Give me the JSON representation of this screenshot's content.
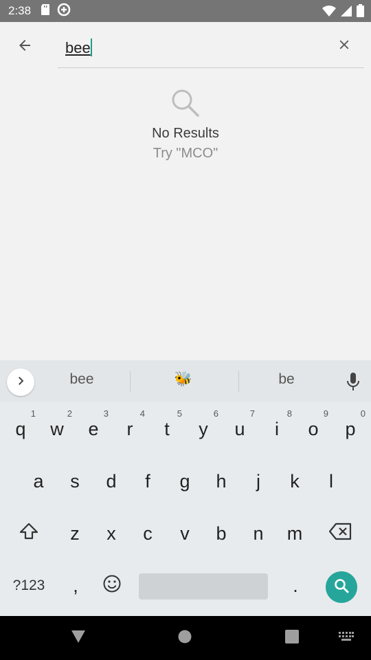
{
  "status_bar": {
    "time": "2:38",
    "left_icons": [
      "sd-card-icon",
      "data-saver-icon"
    ],
    "right_icons": [
      "wifi-icon",
      "cell-signal-icon",
      "battery-icon"
    ]
  },
  "search": {
    "query": "bee",
    "back_icon": "arrow-back-icon",
    "clear_icon": "close-icon"
  },
  "empty_state": {
    "icon": "search-icon",
    "title": "No Results",
    "suggestion": "Try \"MCO\""
  },
  "keyboard": {
    "suggestions": [
      "bee",
      "🐝",
      "be"
    ],
    "row1": [
      {
        "key": "q",
        "hint": "1"
      },
      {
        "key": "w",
        "hint": "2"
      },
      {
        "key": "e",
        "hint": "3"
      },
      {
        "key": "r",
        "hint": "4"
      },
      {
        "key": "t",
        "hint": "5"
      },
      {
        "key": "y",
        "hint": "6"
      },
      {
        "key": "u",
        "hint": "7"
      },
      {
        "key": "i",
        "hint": "8"
      },
      {
        "key": "o",
        "hint": "9"
      },
      {
        "key": "p",
        "hint": "0"
      }
    ],
    "row2": [
      "a",
      "s",
      "d",
      "f",
      "g",
      "h",
      "j",
      "k",
      "l"
    ],
    "row3": [
      "z",
      "x",
      "c",
      "v",
      "b",
      "n",
      "m"
    ],
    "symbols_label": "?123",
    "comma": ",",
    "period": ".",
    "colors": {
      "accent": "#26a69a",
      "cursor": "#1a9e8f"
    }
  },
  "nav_bar": {
    "items": [
      "back-triangle-icon",
      "home-circle-icon",
      "recents-square-icon",
      "keyboard-switch-icon"
    ]
  }
}
